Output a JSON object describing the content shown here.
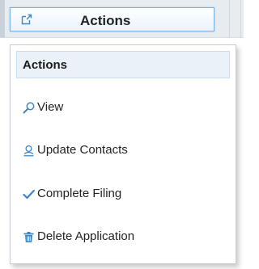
{
  "toolbar": {
    "actions_button_label": "Actions",
    "actions_button_icon": "external-link-icon"
  },
  "menu": {
    "header": "Actions",
    "items": [
      {
        "label": "View",
        "icon": "search-icon"
      },
      {
        "label": "Update Contacts",
        "icon": "user-icon"
      },
      {
        "label": "Complete Filing",
        "icon": "checkmark-icon"
      },
      {
        "label": "Delete Application",
        "icon": "trash-icon"
      }
    ]
  },
  "colors": {
    "accent": "#3d86c6",
    "button_border": "#7fb0e4",
    "header_bg": "#eaf1f8",
    "header_border": "#c7dcee"
  }
}
